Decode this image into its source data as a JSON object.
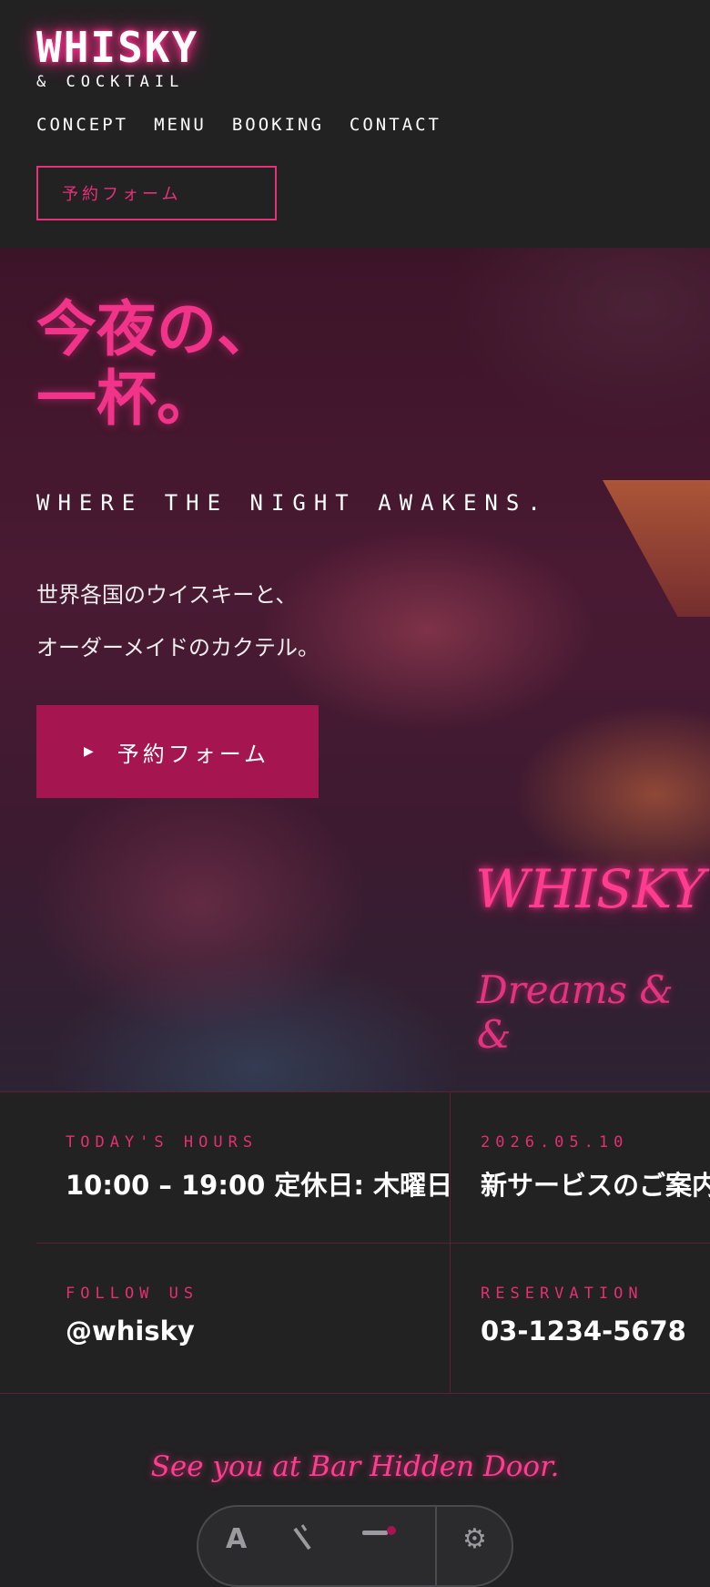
{
  "header": {
    "logo_main": "WHISKY",
    "logo_sub": "& COCKTAIL",
    "nav": [
      "CONCEPT",
      "MENU",
      "BOOKING",
      "CONTACT"
    ],
    "booking_button": "予約フォーム"
  },
  "hero": {
    "title_line1": "今夜の、",
    "title_line2": "一杯。",
    "tagline": "WHERE THE NIGHT AWAKENS.",
    "desc_line1": "世界各国のウイスキーと、",
    "desc_line2": "オーダーメイドのカクテル。",
    "cta_label": "予約フォーム",
    "neon_sign_line1": "WHISKY",
    "neon_sign_line2": "Dreams & &"
  },
  "info": {
    "hours_label": "TODAY'S HOURS",
    "hours_value": "10:00 – 19:00 定休日: 木曜日",
    "news_date": "2026.05.10",
    "news_title": "新サービスのご案内",
    "follow_label": "FOLLOW US",
    "follow_value": "@whisky",
    "reservation_label": "RESERVATION",
    "reservation_value": "03-1234-5678"
  },
  "footer": {
    "tagline": "See you at Bar Hidden Door."
  },
  "toolbar": {
    "icons": [
      "text-icon",
      "magic-wand-icon",
      "settings-slider-icon",
      "gear-icon"
    ]
  },
  "colors": {
    "background": "#222123",
    "accent": "#e8307a",
    "button_fill": "#a5154f"
  }
}
